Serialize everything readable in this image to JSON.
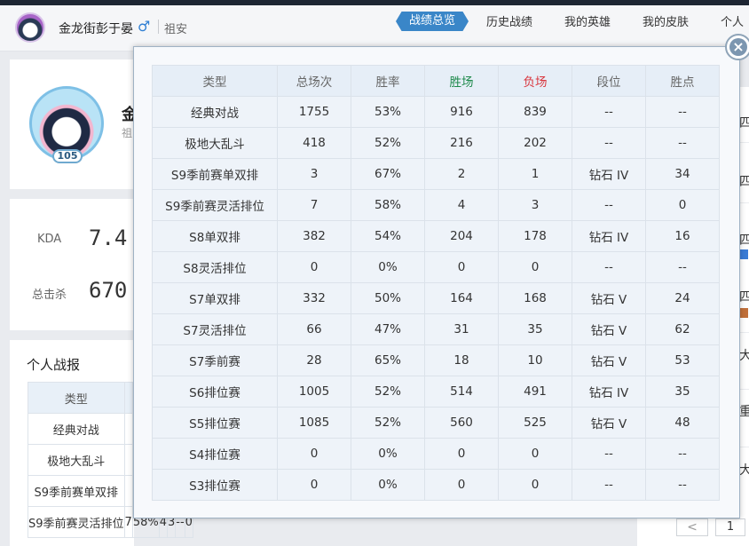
{
  "header": {
    "user_name": "金龙街彭于晏",
    "gender_symbol": "♂",
    "region": "祖安",
    "nav": [
      {
        "label": "战绩总览",
        "active": true
      },
      {
        "label": "历史战绩",
        "active": false
      },
      {
        "label": "我的英雄",
        "active": false
      },
      {
        "label": "我的皮肤",
        "active": false
      },
      {
        "label": "个人",
        "active": false
      }
    ]
  },
  "profile": {
    "name_partial": "金",
    "region_partial": "祖",
    "level": "105"
  },
  "stats": {
    "kda_label": "KDA",
    "kda_value": "7.4",
    "kills_label": "总击杀",
    "kills_value": "670"
  },
  "report": {
    "title": "个人战报",
    "header_type": "类型",
    "rows": [
      {
        "type": "经典对战"
      },
      {
        "type": "极地大乱斗"
      },
      {
        "type": "S9季前赛单双排"
      },
      {
        "type": "S9季前赛灵活排位",
        "c1": "7",
        "c2": "58%",
        "c3": "4",
        "c4": "3",
        "c5": "--",
        "c6": "0"
      }
    ]
  },
  "right_panel": {
    "chars": [
      "四",
      "四",
      "四",
      "四",
      "大",
      "重",
      "大"
    ],
    "pager_prev": "<",
    "pager_current": "1"
  },
  "popup": {
    "close_symbol": "×",
    "headers": [
      "类型",
      "总场次",
      "胜率",
      "胜场",
      "负场",
      "段位",
      "胜点"
    ],
    "rows": [
      [
        "经典对战",
        "1755",
        "53%",
        "916",
        "839",
        "--",
        "--"
      ],
      [
        "极地大乱斗",
        "418",
        "52%",
        "216",
        "202",
        "--",
        "--"
      ],
      [
        "S9季前赛单双排",
        "3",
        "67%",
        "2",
        "1",
        "钻石 IV",
        "34"
      ],
      [
        "S9季前赛灵活排位",
        "7",
        "58%",
        "4",
        "3",
        "--",
        "0"
      ],
      [
        "S8单双排",
        "382",
        "54%",
        "204",
        "178",
        "钻石 IV",
        "16"
      ],
      [
        "S8灵活排位",
        "0",
        "0%",
        "0",
        "0",
        "--",
        "--"
      ],
      [
        "S7单双排",
        "332",
        "50%",
        "164",
        "168",
        "钻石 V",
        "24"
      ],
      [
        "S7灵活排位",
        "66",
        "47%",
        "31",
        "35",
        "钻石 V",
        "62"
      ],
      [
        "S7季前赛",
        "28",
        "65%",
        "18",
        "10",
        "钻石 V",
        "53"
      ],
      [
        "S6排位赛",
        "1005",
        "52%",
        "514",
        "491",
        "钻石 IV",
        "35"
      ],
      [
        "S5排位赛",
        "1085",
        "52%",
        "560",
        "525",
        "钻石 V",
        "48"
      ],
      [
        "S4排位赛",
        "0",
        "0%",
        "0",
        "0",
        "--",
        "--"
      ],
      [
        "S3排位赛",
        "0",
        "0%",
        "0",
        "0",
        "--",
        "--"
      ]
    ]
  },
  "colors": {
    "win": "#1f8a4c",
    "loss": "#d9363e",
    "nav_active": "#3a86c8"
  }
}
